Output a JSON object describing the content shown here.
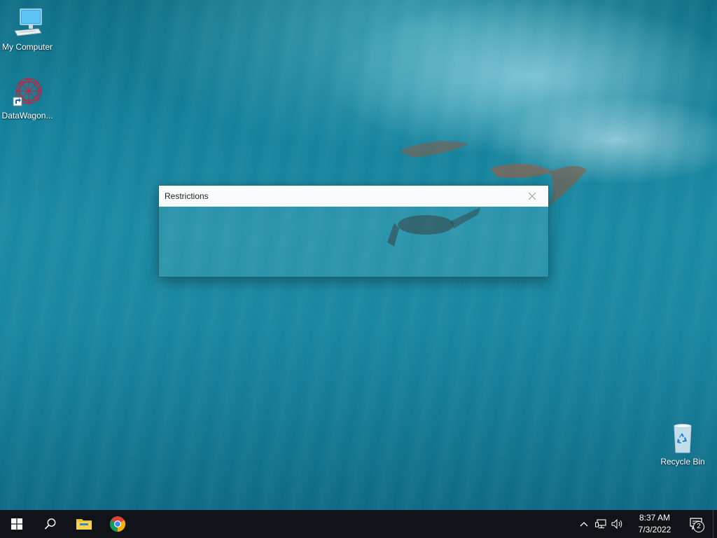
{
  "desktop": {
    "icons": [
      {
        "label": "My Computer",
        "icon": "computer-icon"
      },
      {
        "label": "DataWagon...",
        "icon": "datawagon-icon"
      },
      {
        "label": "Recycle Bin",
        "icon": "recycle-bin-icon"
      }
    ]
  },
  "dialog": {
    "title": "Restrictions",
    "close_icon": "close-icon"
  },
  "taskbar": {
    "start_icon": "windows-start-icon",
    "search_icon": "search-icon",
    "pinned": [
      {
        "icon": "file-explorer-icon"
      },
      {
        "icon": "chrome-icon"
      }
    ],
    "tray": {
      "icons": [
        "chevron-up-icon",
        "network-icon",
        "volume-icon"
      ],
      "time": "8:37 AM",
      "date": "7/3/2022",
      "notification_count": "2"
    }
  },
  "colors": {
    "taskbar_bg": "#101418",
    "windows_blue": "#1e90ff",
    "chrome_red": "#db4437",
    "chrome_yellow": "#f4b400",
    "chrome_green": "#0f9d58",
    "chrome_blue": "#4285f4",
    "folder_yellow": "#f0c419"
  }
}
